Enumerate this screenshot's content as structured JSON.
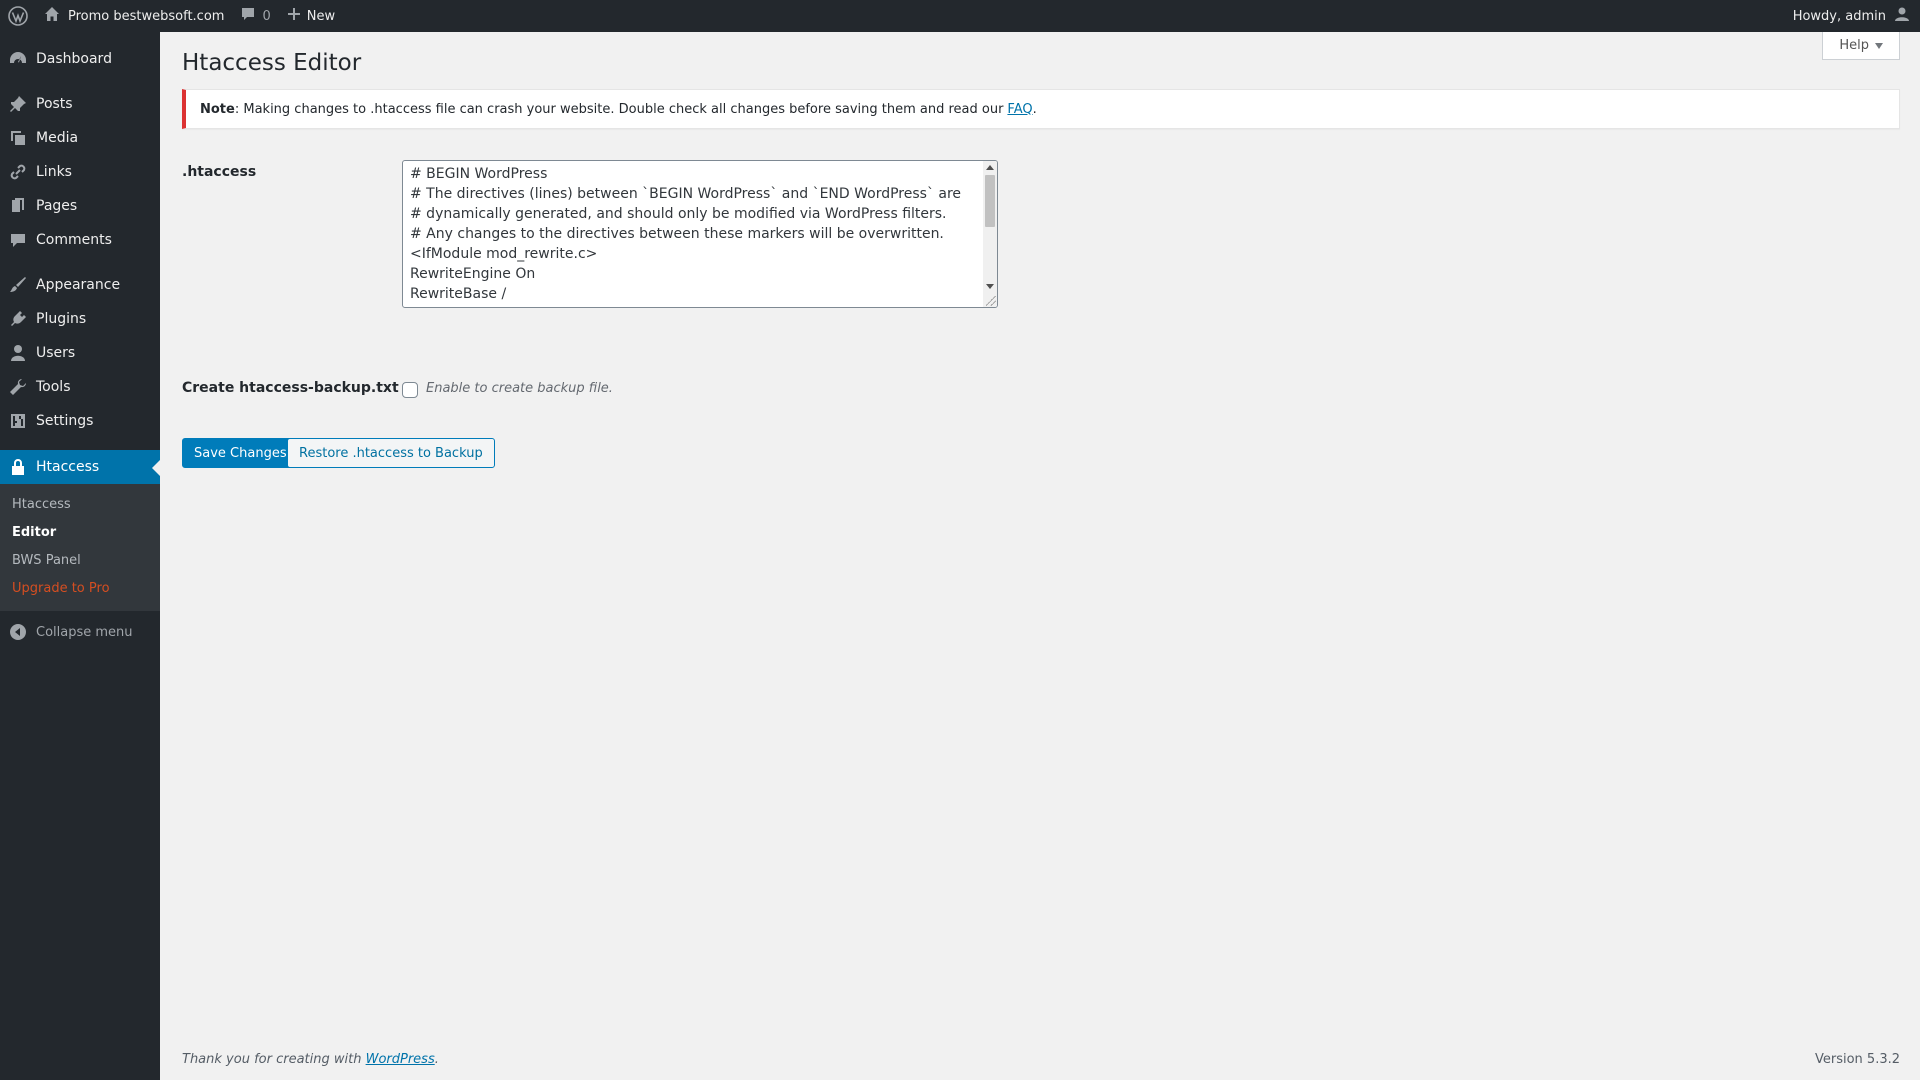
{
  "adminbar": {
    "site_name": "Promo bestwebsoft.com",
    "comments_count": "0",
    "new_label": "New",
    "howdy": "Howdy, admin"
  },
  "sidebar": {
    "items": [
      {
        "label": "Dashboard",
        "icon": "dashboard-icon"
      },
      {
        "label": "Posts",
        "icon": "pushpin-icon"
      },
      {
        "label": "Media",
        "icon": "media-icon"
      },
      {
        "label": "Links",
        "icon": "link-icon"
      },
      {
        "label": "Pages",
        "icon": "page-icon"
      },
      {
        "label": "Comments",
        "icon": "comment-icon"
      },
      {
        "label": "Appearance",
        "icon": "brush-icon"
      },
      {
        "label": "Plugins",
        "icon": "plug-icon"
      },
      {
        "label": "Users",
        "icon": "user-icon"
      },
      {
        "label": "Tools",
        "icon": "wrench-icon"
      },
      {
        "label": "Settings",
        "icon": "settings-icon"
      },
      {
        "label": "Htaccess",
        "icon": "lock-icon"
      }
    ],
    "submenu": [
      "Htaccess",
      "Editor",
      "BWS Panel",
      "Upgrade to Pro"
    ],
    "collapse_label": "Collapse menu"
  },
  "help_label": "Help",
  "page_title": "Htaccess Editor",
  "notice": {
    "strong": "Note",
    "text": ": Making changes to .htaccess file can crash your website. Double check all changes before saving them and read our",
    "link": "FAQ",
    "end": "."
  },
  "form": {
    "htaccess_label": ".htaccess",
    "htaccess_content": "# BEGIN WordPress\n# The directives (lines) between `BEGIN WordPress` and `END WordPress` are\n# dynamically generated, and should only be modified via WordPress filters.\n# Any changes to the directives between these markers will be overwritten.\n<IfModule mod_rewrite.c>\nRewriteEngine On\nRewriteBase /\nRewriteRule ^index\\.php$ - [L]",
    "backup_label": "Create htaccess-backup.txt",
    "backup_desc": "Enable to create backup file.",
    "backup_checked": false
  },
  "buttons": {
    "save": "Save Changes",
    "restore": "Restore .htaccess to Backup"
  },
  "footer": {
    "thanks_prefix": "Thank you for creating with",
    "thanks_link": "WordPress",
    "thanks_suffix": ".",
    "version": "Version 5.3.2"
  },
  "colors": {
    "accent": "#0073aa",
    "notice_border": "#dc3232",
    "upgrade": "#d54e21"
  }
}
